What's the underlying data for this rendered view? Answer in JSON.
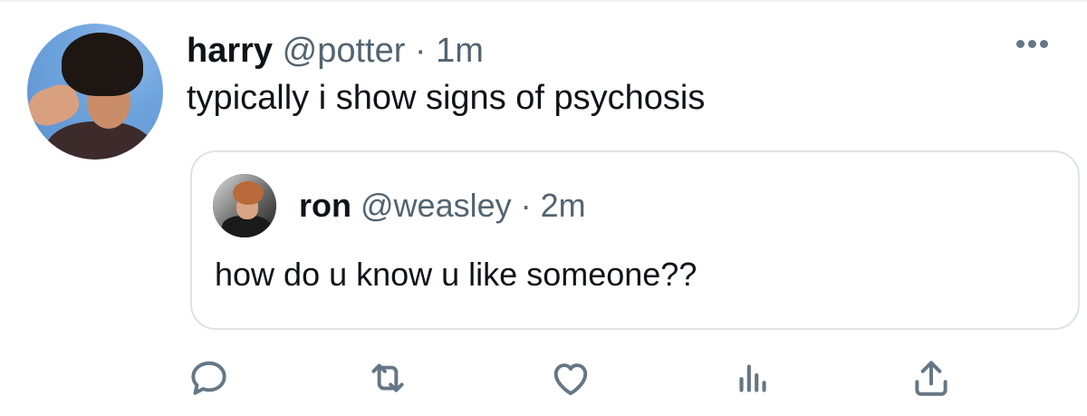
{
  "tweet": {
    "author_name": "harry",
    "author_handle": "@potter",
    "separator": " · ",
    "time": "1m",
    "text": "typically i show signs of psychosis"
  },
  "quoted_tweet": {
    "author_name": "ron",
    "author_handle": "@weasley",
    "separator": " · ",
    "time": "2m",
    "text": "how do u know u like someone??"
  },
  "actions": [
    "reply-icon",
    "retweet-icon",
    "like-icon",
    "analytics-icon",
    "share-icon"
  ],
  "colors": {
    "text": "#0f1419",
    "muted": "#536471",
    "icon": "#657786",
    "border": "#dde3e8"
  }
}
